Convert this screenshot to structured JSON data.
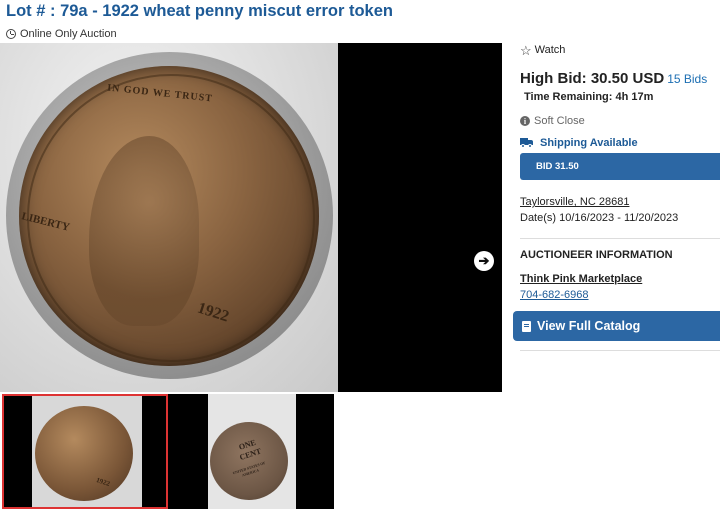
{
  "lot": {
    "title": "Lot # : 79a - 1922 wheat penny miscut error token",
    "auction_type": "Online Only Auction"
  },
  "gallery": {
    "coin_obverse_text": {
      "motto": "IN GOD WE TRUST",
      "liberty": "LIBERTY",
      "year": "1922"
    },
    "coin_reverse_text": {
      "denomination": "ONE CENT",
      "country": "UNITED STATES OF AMERICA"
    },
    "next_icon": "arrow-right-circle-icon"
  },
  "sidebar": {
    "watch_label": "Watch",
    "high_bid_label": "High Bid: 30.50 USD",
    "bids_count": "15 Bids",
    "time_remaining": "Time Remaining: 4h 17m",
    "soft_close": "Soft Close",
    "shipping": "Shipping Available",
    "bid_button": "BID 31.50",
    "location": "Taylorsville, NC 28681",
    "dates": "Date(s) 10/16/2023 - 11/20/2023",
    "auctioneer_heading": "AUCTIONEER INFORMATION",
    "auctioneer_name": "Think Pink Marketplace",
    "phone": "704-682-6968",
    "catalog_button": "View Full Catalog"
  },
  "colors": {
    "title_blue": "#1d5a96",
    "button_blue": "#2c67a4",
    "link_blue": "#1d6fb3",
    "selected_thumb_border": "#dd3333"
  }
}
